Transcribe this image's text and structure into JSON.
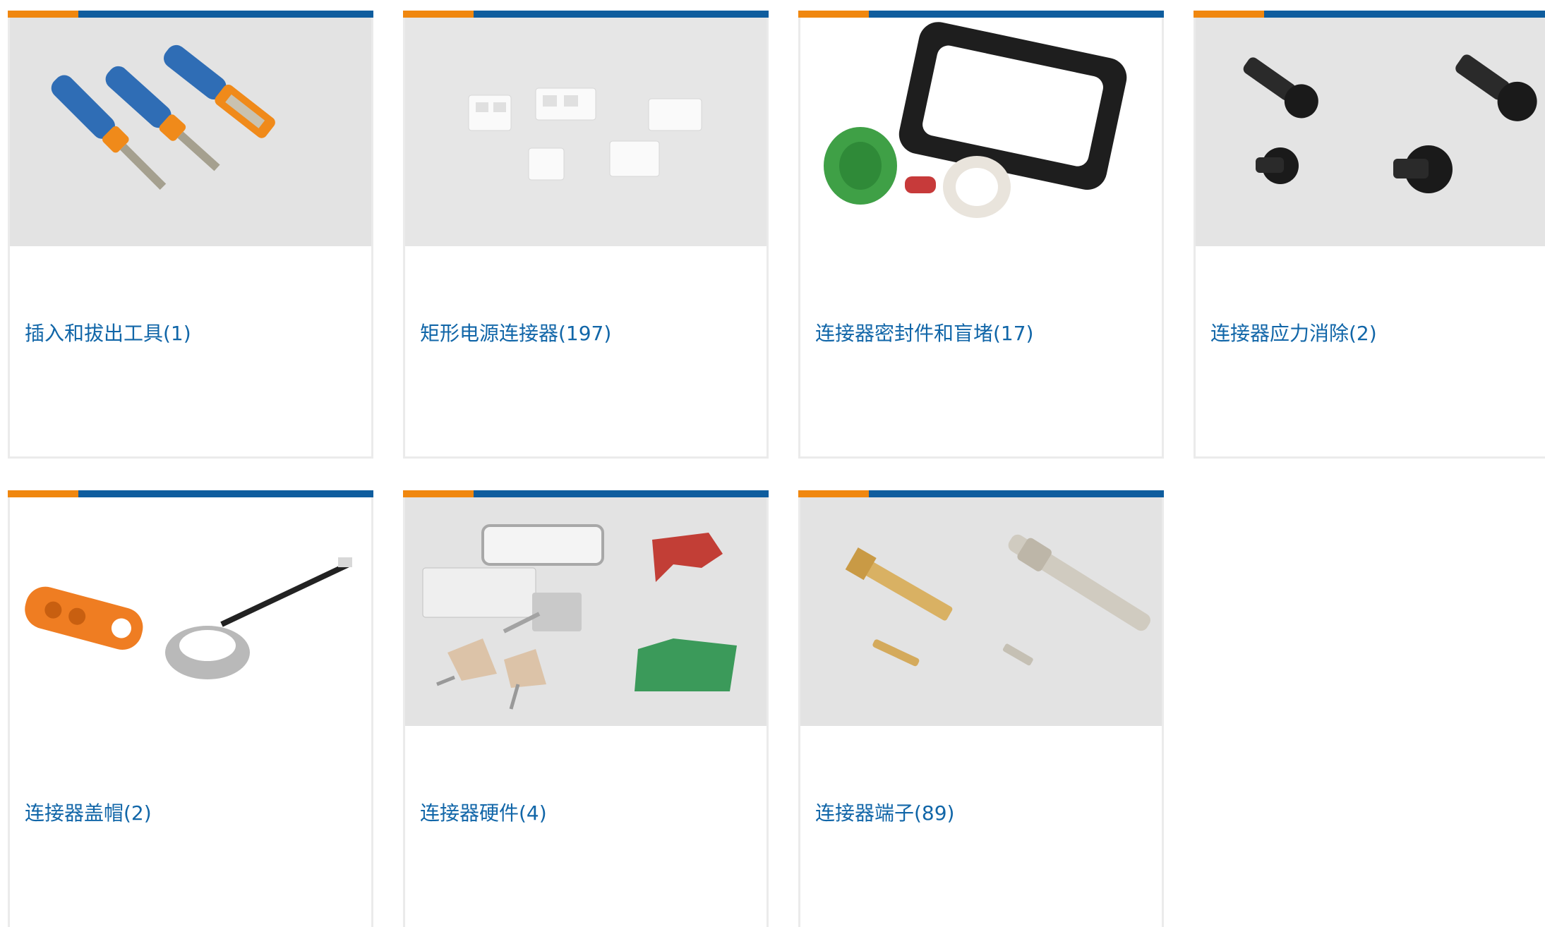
{
  "colors": {
    "accent_orange": "#f0870f",
    "accent_blue": "#0f5d9e",
    "link_blue": "#1166a8",
    "border": "#ebebeb",
    "thumb_bg": "#e4e4e4"
  },
  "categories": [
    {
      "label": "插入和拔出工具(1)",
      "image": "extraction-tools"
    },
    {
      "label": "矩形电源连接器(197)",
      "image": "rectangular-power-connectors"
    },
    {
      "label": "连接器密封件和盲堵(17)",
      "image": "connector-seals"
    },
    {
      "label": "连接器应力消除(2)",
      "image": "strain-relief"
    },
    {
      "label": "连接器盖帽(2)",
      "image": "connector-caps"
    },
    {
      "label": "连接器硬件(4)",
      "image": "connector-hardware"
    },
    {
      "label": "连接器端子(89)",
      "image": "connector-terminals"
    }
  ]
}
